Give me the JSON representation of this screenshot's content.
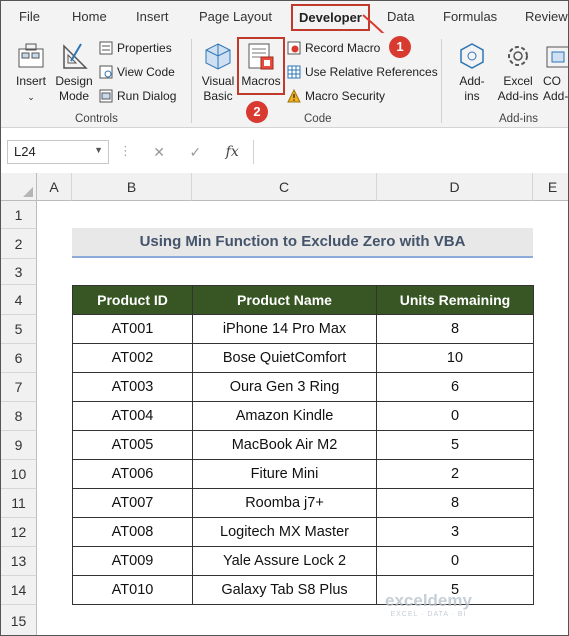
{
  "tabs": {
    "file": "File",
    "home": "Home",
    "insert": "Insert",
    "page_layout": "Page Layout",
    "developer": "Developer",
    "data": "Data",
    "formulas": "Formulas",
    "review": "Review"
  },
  "callouts": {
    "one": "1",
    "two": "2"
  },
  "ribbon": {
    "controls": {
      "insert": "Insert",
      "design_mode_1": "Design",
      "design_mode_2": "Mode",
      "properties": "Properties",
      "view_code": "View Code",
      "run_dialog": "Run Dialog",
      "group_label": "Controls"
    },
    "code": {
      "visual_basic_1": "Visual",
      "visual_basic_2": "Basic",
      "macros": "Macros",
      "record_macro": "Record Macro",
      "relative_refs": "Use Relative References",
      "macro_security": "Macro Security",
      "group_label": "Code"
    },
    "addins": {
      "addins_1": "Add-",
      "addins_2": "ins",
      "excel_addins_1": "Excel",
      "excel_addins_2": "Add-ins",
      "com_addins_1": "CO",
      "com_addins_2": "Add-",
      "group_label": "Add-ins"
    }
  },
  "formula_bar": {
    "name_box": "L24",
    "cancel_icon": "✕",
    "enter_icon": "✓",
    "fx_label": "fx",
    "value": ""
  },
  "columns": [
    "A",
    "B",
    "C",
    "D",
    "E"
  ],
  "rows": [
    "1",
    "2",
    "3",
    "4",
    "5",
    "6",
    "7",
    "8",
    "9",
    "10",
    "11",
    "12",
    "13",
    "14",
    "15"
  ],
  "sheet": {
    "title": "Using Min Function to Exclude Zero with VBA",
    "headers": [
      "Product ID",
      "Product Name",
      "Units Remaining"
    ],
    "records": [
      [
        "AT001",
        "iPhone 14 Pro Max",
        "8"
      ],
      [
        "AT002",
        "Bose QuietComfort",
        "10"
      ],
      [
        "AT003",
        "Oura Gen 3 Ring",
        "6"
      ],
      [
        "AT004",
        "Amazon Kindle",
        "0"
      ],
      [
        "AT005",
        "MacBook Air M2",
        "5"
      ],
      [
        "AT006",
        "Fiture Mini",
        "2"
      ],
      [
        "AT007",
        "Roomba j7+",
        "8"
      ],
      [
        "AT008",
        "Logitech MX Master",
        "3"
      ],
      [
        "AT009",
        "Yale Assure Lock 2",
        "0"
      ],
      [
        "AT010",
        "Galaxy Tab S8 Plus",
        "5"
      ]
    ]
  },
  "watermark": {
    "brand": "exceldemy",
    "tagline": "EXCEL · DATA · BI"
  },
  "colors": {
    "header_fill": "#375623",
    "title_text": "#44546a",
    "title_underline": "#8eaadb",
    "highlight": "#c0392b"
  }
}
